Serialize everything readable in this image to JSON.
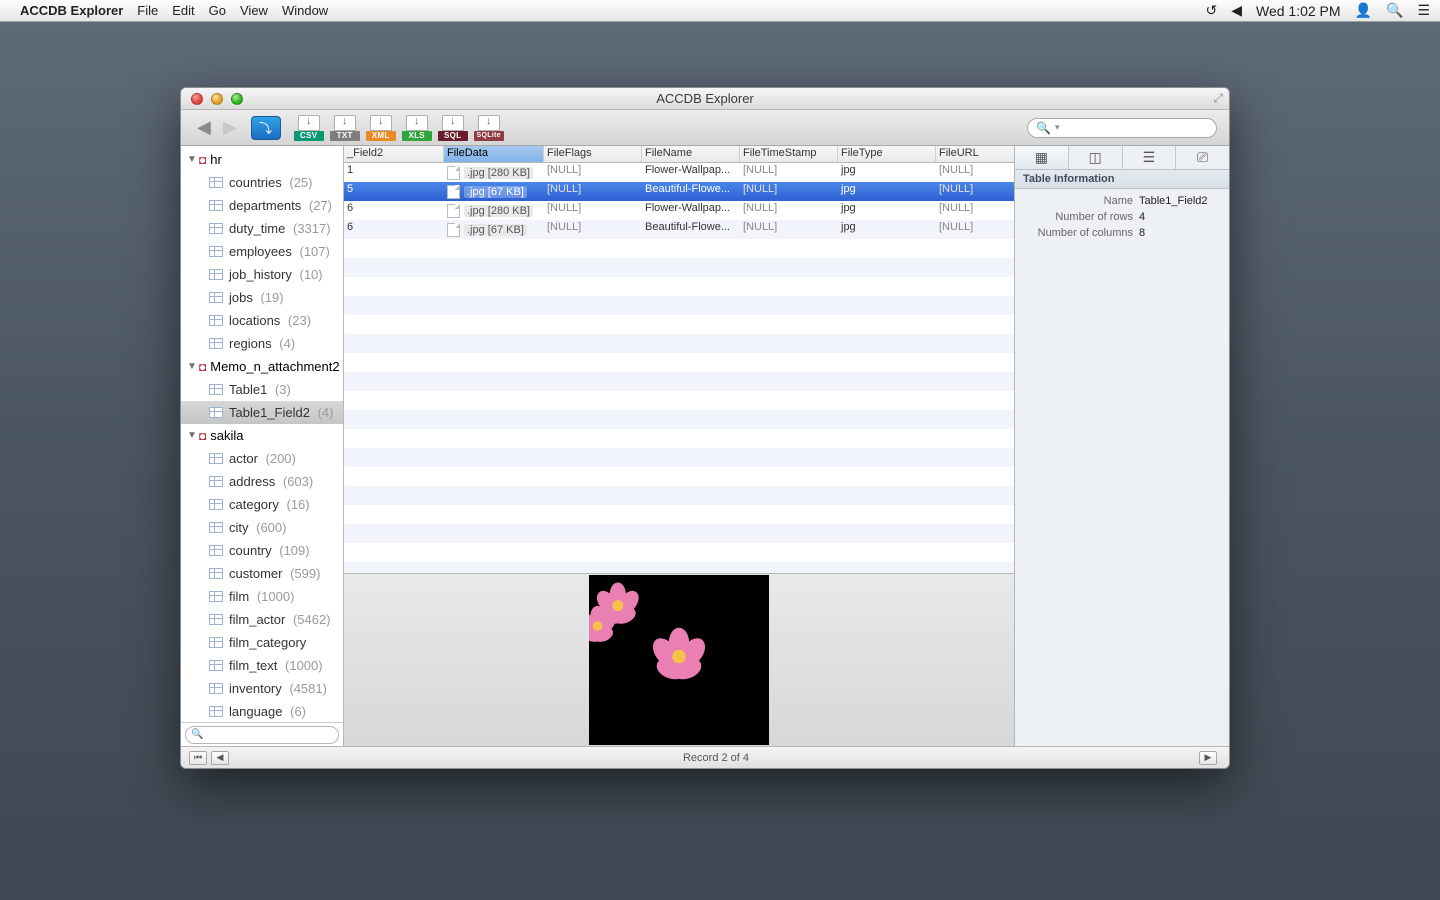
{
  "menubar": {
    "app": "ACCDB Explorer",
    "items": [
      "File",
      "Edit",
      "Go",
      "View",
      "Window"
    ],
    "clock": "Wed 1:02 PM"
  },
  "window": {
    "title": "ACCDB Explorer",
    "search_placeholder": "",
    "export_buttons": [
      "CSV",
      "TXT",
      "XML",
      "XLS",
      "SQL",
      "SQLite"
    ],
    "status": "Record 2 of 4"
  },
  "sidebar": {
    "databases": [
      {
        "name": "hr",
        "expanded": true,
        "tables": [
          {
            "name": "countries",
            "count": "(25)"
          },
          {
            "name": "departments",
            "count": "(27)"
          },
          {
            "name": "duty_time",
            "count": "(3317)"
          },
          {
            "name": "employees",
            "count": "(107)"
          },
          {
            "name": "job_history",
            "count": "(10)"
          },
          {
            "name": "jobs",
            "count": "(19)"
          },
          {
            "name": "locations",
            "count": "(23)"
          },
          {
            "name": "regions",
            "count": "(4)"
          }
        ]
      },
      {
        "name": "Memo_n_attachment2",
        "expanded": true,
        "tables": [
          {
            "name": "Table1",
            "count": "(3)"
          },
          {
            "name": "Table1_Field2",
            "count": "(4)",
            "selected": true
          }
        ]
      },
      {
        "name": "sakila",
        "expanded": true,
        "tables": [
          {
            "name": "actor",
            "count": "(200)"
          },
          {
            "name": "address",
            "count": "(603)"
          },
          {
            "name": "category",
            "count": "(16)"
          },
          {
            "name": "city",
            "count": "(600)"
          },
          {
            "name": "country",
            "count": "(109)"
          },
          {
            "name": "customer",
            "count": "(599)"
          },
          {
            "name": "film",
            "count": "(1000)"
          },
          {
            "name": "film_actor",
            "count": "(5462)"
          },
          {
            "name": "film_category",
            "count": ""
          },
          {
            "name": "film_text",
            "count": "(1000)"
          },
          {
            "name": "inventory",
            "count": "(4581)"
          },
          {
            "name": "language",
            "count": "(6)"
          }
        ]
      }
    ]
  },
  "grid": {
    "columns": [
      "_Field2",
      "FileData",
      "FileFlags",
      "FileName",
      "FileTimeStamp",
      "FileType",
      "FileURL"
    ],
    "rows": [
      {
        "f": "1",
        "data": ".jpg [280 KB]",
        "flags": "[NULL]",
        "name": "Flower-Wallpap...",
        "ts": "[NULL]",
        "type": "jpg",
        "url": "[NULL]"
      },
      {
        "f": "5",
        "data": ".jpg [67 KB]",
        "flags": "[NULL]",
        "name": "Beautiful-Flowe...",
        "ts": "[NULL]",
        "type": "jpg",
        "url": "[NULL]",
        "selected": true
      },
      {
        "f": "6",
        "data": ".jpg [280 KB]",
        "flags": "[NULL]",
        "name": "Flower-Wallpap...",
        "ts": "[NULL]",
        "type": "jpg",
        "url": "[NULL]"
      },
      {
        "f": "6",
        "data": ".jpg [67 KB]",
        "flags": "[NULL]",
        "name": "Beautiful-Flowe...",
        "ts": "[NULL]",
        "type": "jpg",
        "url": "[NULL]"
      }
    ]
  },
  "inspector": {
    "section": "Table Information",
    "props": [
      {
        "label": "Name",
        "value": "Table1_Field2"
      },
      {
        "label": "Number of rows",
        "value": "4"
      },
      {
        "label": "Number of columns",
        "value": "8"
      }
    ]
  }
}
